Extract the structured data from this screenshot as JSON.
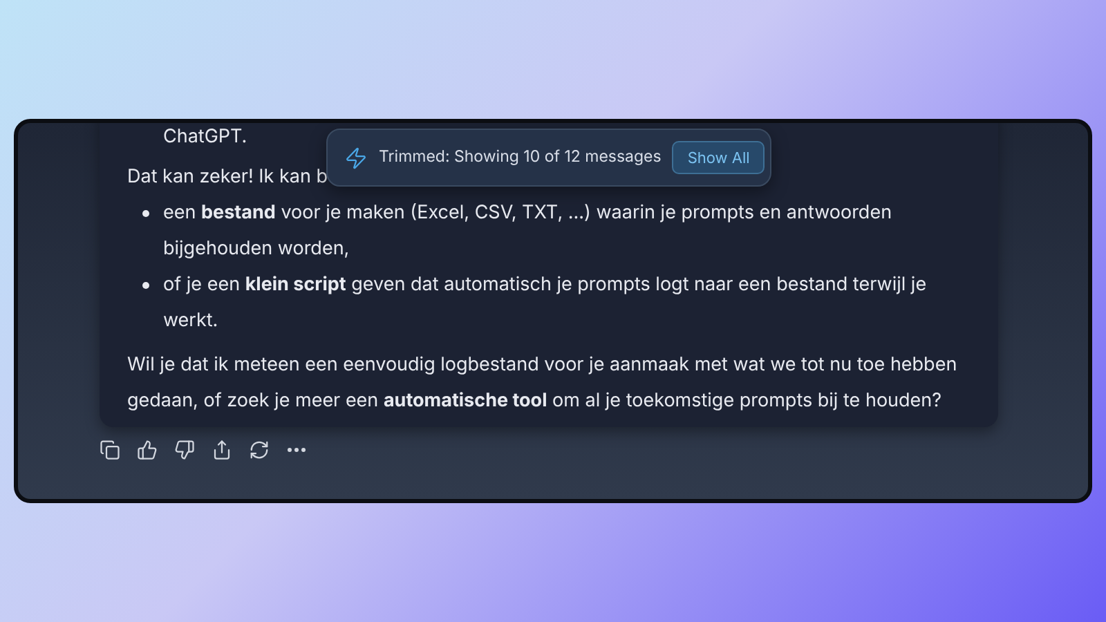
{
  "message": {
    "lead_fragment": "ChatGPT.",
    "intro": "Dat kan zeker! Ik kan b",
    "bullets": [
      "een **bestand** voor je maken (Excel, CSV, TXT, ...) waarin je prompts en antwoorden bijgehouden worden,",
      "of je een **klein script** geven dat automatisch je prompts logt naar een bestand terwijl je werkt."
    ],
    "closing": "Wil je dat ik meteen een eenvoudig logbestand voor je aanmaak met wat we tot nu toe hebben gedaan, of zoek je meer een **automatische tool** om al je toekomstige prompts bij te houden?"
  },
  "toast": {
    "text": "Trimmed: Showing 10 of 12 messages",
    "button": "Show All"
  },
  "actions": [
    {
      "kind": "copy"
    },
    {
      "kind": "like"
    },
    {
      "kind": "dislike"
    },
    {
      "kind": "share"
    },
    {
      "kind": "regenerate"
    },
    {
      "kind": "more"
    }
  ]
}
